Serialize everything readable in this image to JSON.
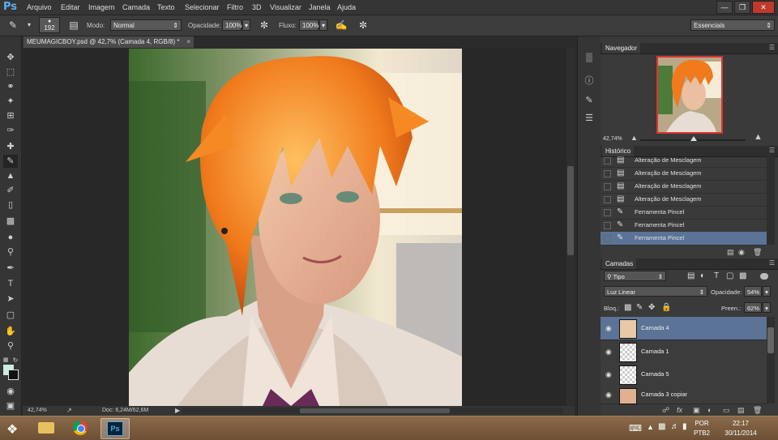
{
  "app": {
    "logo": "Ps"
  },
  "menu": [
    "Arquivo",
    "Editar",
    "Imagem",
    "Camada",
    "Texto",
    "Selecionar",
    "Filtro",
    "3D",
    "Visualizar",
    "Janela",
    "Ajuda"
  ],
  "window_controls": [
    "minimize",
    "restore",
    "close"
  ],
  "options_bar": {
    "brush_size": "192",
    "mode_label": "Modo:",
    "mode_value": "Normal",
    "opacity_label": "Opacidade:",
    "opacity_value": "100%",
    "flow_label": "Fluxo:",
    "flow_value": "100%",
    "workspace": "Essenciais"
  },
  "document": {
    "tab_title": "MEUMAGICBOY.psd @ 42,7% (Camada 4, RGB/8) *",
    "close": "×",
    "zoom": "42,74%",
    "doc_size": "Doc: 6,24M/62,6M"
  },
  "navigator": {
    "title": "Navegador",
    "zoom": "42,74%"
  },
  "history": {
    "title": "Histórico",
    "items": [
      {
        "label": "Alteração de Mesclagem",
        "icon": "document-icon"
      },
      {
        "label": "Alteração de Mesclagem",
        "icon": "document-icon"
      },
      {
        "label": "Alteração de Mesclagem",
        "icon": "document-icon"
      },
      {
        "label": "Alteração de Mesclagem",
        "icon": "document-icon"
      },
      {
        "label": "Ferramenta Pincel",
        "icon": "brush-icon"
      },
      {
        "label": "Ferramenta Pincel",
        "icon": "brush-icon"
      },
      {
        "label": "Ferramenta Pincel",
        "icon": "brush-icon",
        "selected": true
      }
    ]
  },
  "layers": {
    "title": "Camadas",
    "filter_kind": "Tipo",
    "blend_mode": "Luz Linear",
    "opacity_label": "Opacidade:",
    "opacity_value": "54%",
    "lock_label": "Bloq.:",
    "fill_label": "Preen.:",
    "fill_value": "62%",
    "items": [
      {
        "name": "Camada 4",
        "selected": true
      },
      {
        "name": "Camada 1"
      },
      {
        "name": "Camada 5"
      },
      {
        "name": "Camada 3 copiar"
      }
    ]
  },
  "taskbar": {
    "apps": [
      "explorer-icon",
      "chrome-icon",
      "photoshop-icon"
    ],
    "lang_top": "POR",
    "lang_bottom": "PTB2",
    "time": "22:17",
    "date": "30/11/2014"
  },
  "colors": {
    "foreground": "#c8f0e0",
    "background": "#111111",
    "selection": "#5a7396"
  }
}
